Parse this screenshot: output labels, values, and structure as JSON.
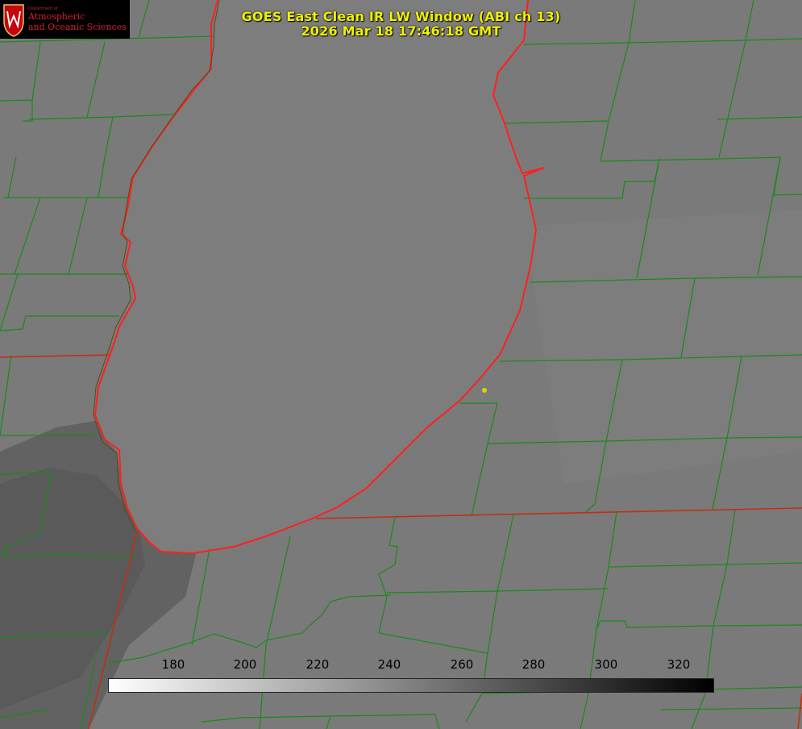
{
  "title": {
    "line1": "GOES East Clean IR LW Window (ABI ch 13)",
    "line2": "2026 Mar 18 17:46:18 GMT"
  },
  "logo": {
    "dept": "Department of",
    "line1": "Atmospheric",
    "line2": "and Oceanic Sciences"
  },
  "colorbar": {
    "ticks": [
      "180",
      "200",
      "220",
      "240",
      "260",
      "280",
      "300",
      "320"
    ],
    "gradient_from": "#ffffff",
    "gradient_to": "#000000"
  },
  "colors": {
    "county_lines": "#1a8a1a",
    "state_lines": "#c03010",
    "lake_shoreline": "#ff2020",
    "marker": "#e0d000",
    "title": "#f0f000"
  }
}
